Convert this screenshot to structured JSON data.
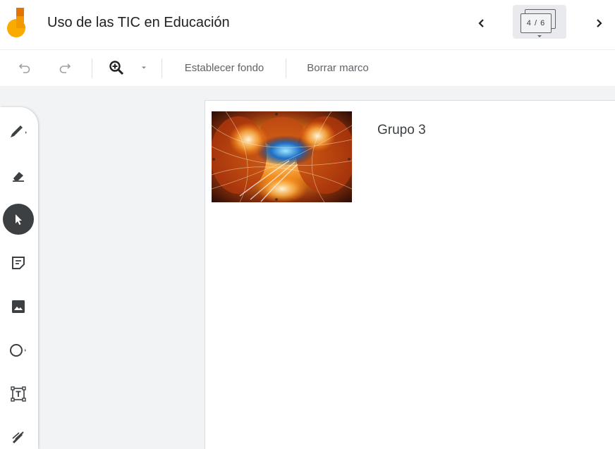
{
  "app": {
    "name": "Jamboard",
    "title": "Uso de las TIC en Educación",
    "brand_colors": {
      "yellow": "#F9AB00",
      "orange": "#E37400",
      "dark": "#3C4043"
    }
  },
  "header": {
    "prev_icon": "chevron-left-icon",
    "next_icon": "chevron-right-icon",
    "frame_counter": "4 / 6",
    "frame_current": 4,
    "frame_total": 6
  },
  "toolbar": {
    "undo_icon": "undo-icon",
    "redo_icon": "redo-icon",
    "zoom_icon": "zoom-in-icon",
    "zoom_dropdown_icon": "caret-down-icon",
    "set_background_label": "Establecer fondo",
    "clear_frame_label": "Borrar marco"
  },
  "tools": [
    {
      "name": "pen",
      "icon": "pen-icon",
      "has_submenu": true
    },
    {
      "name": "eraser",
      "icon": "eraser-icon",
      "has_submenu": false
    },
    {
      "name": "select",
      "icon": "select-arrow-icon",
      "active": true
    },
    {
      "name": "sticky-note",
      "icon": "sticky-note-icon"
    },
    {
      "name": "image",
      "icon": "image-icon"
    },
    {
      "name": "circle",
      "icon": "circle-shape-icon",
      "has_submenu": true
    },
    {
      "name": "text-box",
      "icon": "text-box-icon"
    },
    {
      "name": "laser",
      "icon": "laser-icon"
    }
  ],
  "canvas": {
    "text_box": "Grupo 3",
    "image": "abstract-fractal-image"
  }
}
